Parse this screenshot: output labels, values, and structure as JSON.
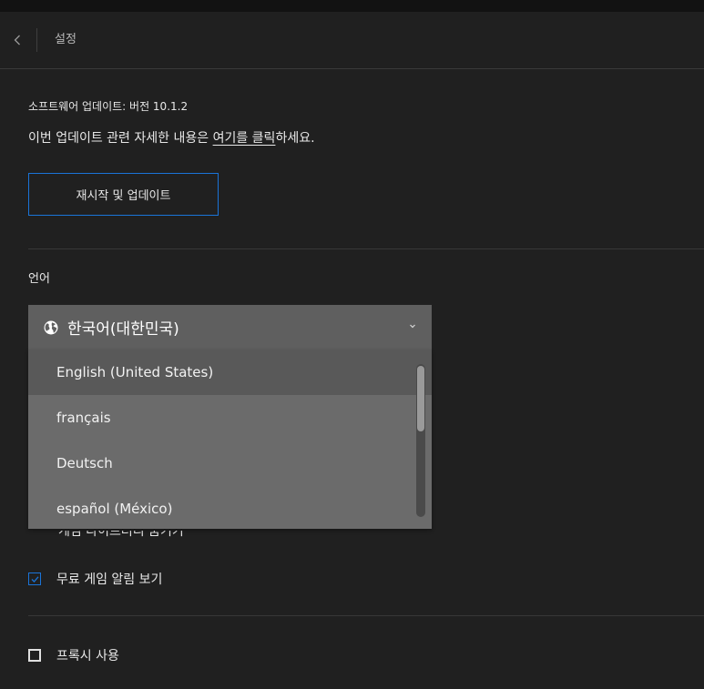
{
  "header": {
    "title": "설정"
  },
  "update": {
    "label": "소프트웨어 업데이트: 버전 10.1.2",
    "desc_prefix": "이번 업데이트 관련 자세한 내용은 ",
    "desc_link": "여기를 클릭",
    "desc_suffix": "하세요.",
    "restart_button": "재시작 및 업데이트"
  },
  "language": {
    "label": "언어",
    "selected": "한국어(대한민국)",
    "options": [
      "English (United States)",
      "français",
      "Deutsch",
      "español (México)"
    ]
  },
  "options": {
    "obscured_label": "게임 라이브러리 숨기기",
    "free_games": "무료 게임 알림 보기",
    "free_games_checked": true,
    "proxy": "프록시 사용",
    "proxy_checked": false
  },
  "colors": {
    "accent": "#1a74d8",
    "background": "#202020",
    "dropdown": "#6b6b6b"
  },
  "icons": {
    "back": "chevron-left-icon",
    "globe": "globe-icon",
    "dropdown": "chevron-down-icon",
    "check": "checkmark-icon"
  }
}
